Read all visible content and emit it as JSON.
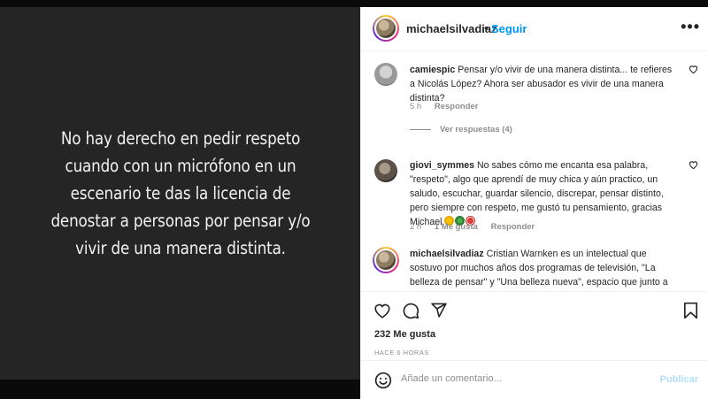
{
  "post": {
    "text": "No hay derecho en pedir respeto cuando con un micrófono en un escenario te das la licencia de denostar a personas por pensar y/o vivir de una manera distinta."
  },
  "header": {
    "username": "michaelsilvadiaz",
    "separator": "•",
    "follow_label": "Seguir",
    "more_icon": "more-horizontal-icon"
  },
  "comments": [
    {
      "username": "camiespic",
      "text": "Pensar y/o vivir de una manera distinta... te refieres a Nicolás López? Ahora ser abusador es vivir de una manera distinta?",
      "time": "5 h",
      "reply_label": "Responder",
      "view_replies": "Ver respuestas (4)"
    },
    {
      "username": "giovi_symmes",
      "text": "No sabes cómo me encanta esa palabra, \"respeto\", algo que aprendí de muy chica y aún practico, un saludo, escuchar, guardar silencio, discrepar, pensar distinto, pero siempre con respeto, me gustó tu pensamiento, gracias Michael",
      "time": "2 h",
      "likes": "1 Me gusta",
      "reply_label": "Responder"
    },
    {
      "username": "michaelsilvadiaz",
      "text": "Cristian Warnken es un intelectual que sostuvo por muchos años dos programas de televisión, \"La belleza de pensar\" y \"Una belleza nueva\", espacio que junto a"
    }
  ],
  "actions": {
    "like_icon": "heart-icon",
    "comment_icon": "comment-icon",
    "share_icon": "share-icon",
    "save_icon": "bookmark-icon",
    "likes_count": "232 Me gusta",
    "time_ago": "HACE 6 HORAS"
  },
  "add_comment": {
    "emoji_icon": "emoji-icon",
    "placeholder": "Añade un comentario...",
    "post_label": "Publicar"
  },
  "colors": {
    "media_bg": "#252525",
    "accent": "#0095f6",
    "muted": "#8e8e8e",
    "post_disabled": "#b2dffc"
  }
}
